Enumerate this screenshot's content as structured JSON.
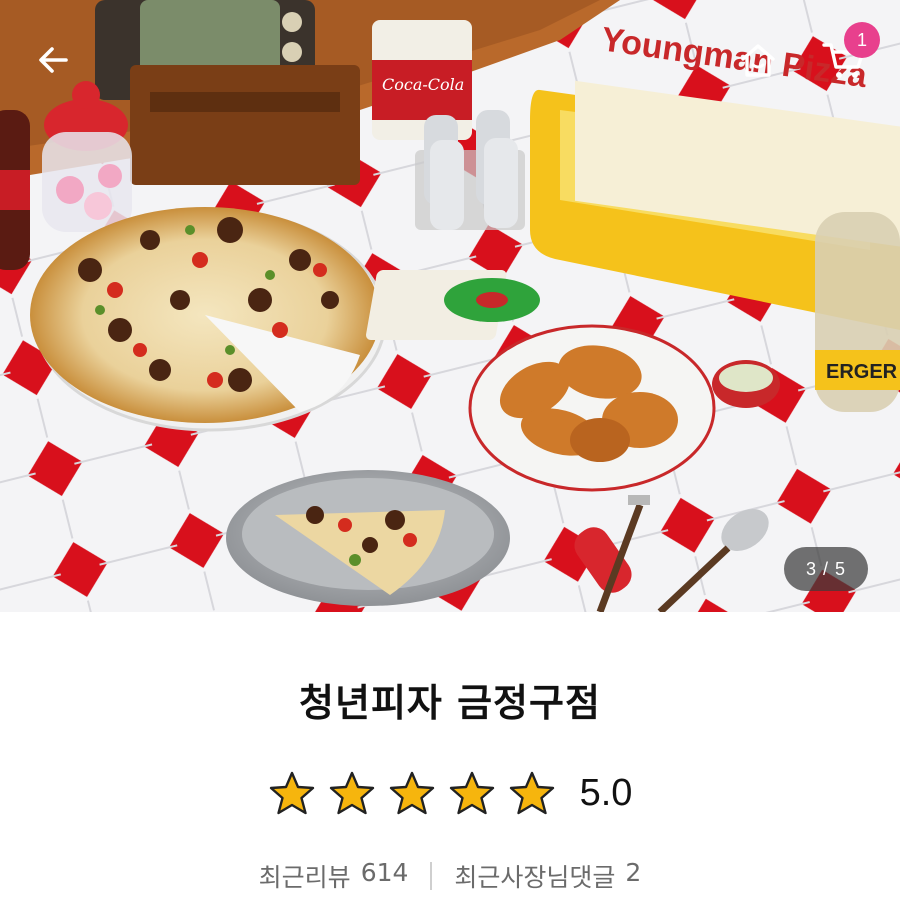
{
  "header": {
    "back_icon": "arrow-left-icon",
    "home_icon": "home-icon",
    "cart_icon": "cart-icon",
    "cart_count": "1",
    "cart_badge_color": "#e8408d"
  },
  "gallery": {
    "counter": "3 / 5",
    "photo_sign_text": "Youngman Pizza",
    "photo_can_text": "Coca-Cola",
    "photo_bottle_text": "ERGER"
  },
  "store": {
    "name": "청년피자 금정구점",
    "rating_value": "5.0",
    "rating_stars": 5,
    "star_color": "#f6b50d",
    "recent_reviews_label": "최근리뷰",
    "recent_reviews_count": "614",
    "owner_replies_label": "최근사장님댓글",
    "owner_replies_count": "2"
  }
}
